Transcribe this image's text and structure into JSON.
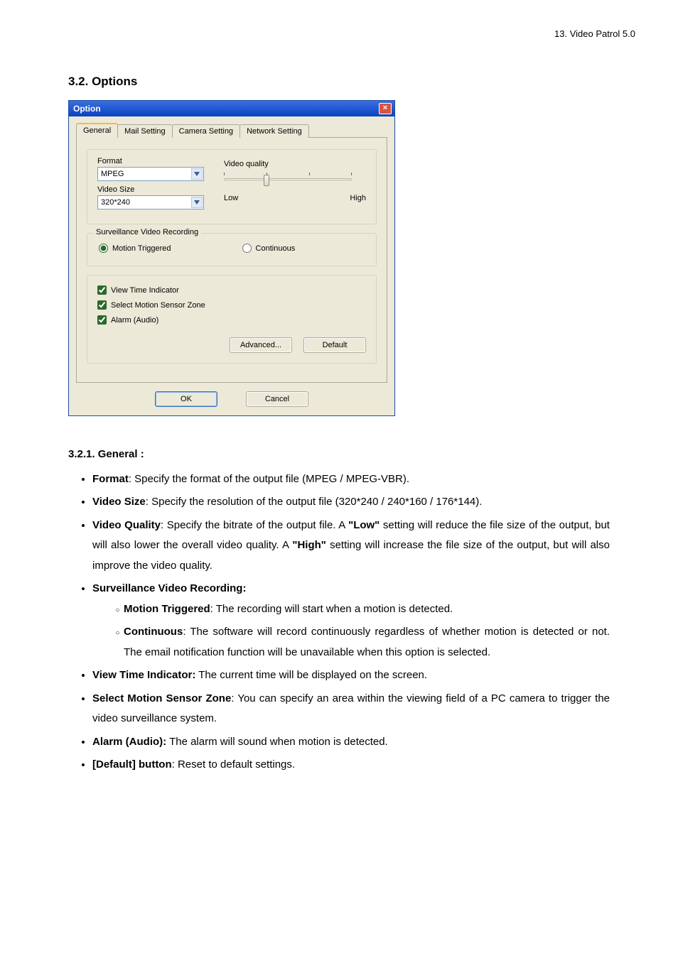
{
  "page": {
    "header_right": "13. Video Patrol 5.0",
    "section_title": "3.2. Options"
  },
  "dialog": {
    "title": "Option",
    "close_glyph": "×",
    "tabs": [
      "General",
      "Mail Setting",
      "Camera Setting",
      "Network Setting"
    ],
    "general": {
      "format_label": "Format",
      "format_value": "MPEG",
      "video_size_label": "Video Size",
      "video_size_value": "320*240",
      "video_quality_label": "Video quality",
      "slider_low": "Low",
      "slider_high": "High",
      "recording_legend": "Surveillance Video Recording",
      "radio_motion": "Motion Triggered",
      "radio_continuous": "Continuous",
      "check_view_time": "View Time Indicator",
      "check_sensor_zone": "Select Motion Sensor Zone",
      "check_alarm": "Alarm (Audio)",
      "btn_advanced": "Advanced...",
      "btn_default": "Default",
      "btn_ok": "OK",
      "btn_cancel": "Cancel"
    }
  },
  "doc": {
    "sub_title": "3.2.1. General :",
    "i1a": "Format",
    "i1b": ": Specify the format of the output file (MPEG / MPEG-VBR).",
    "i2a": "Video Size",
    "i2b": ": Specify the resolution of the output file (320*240 / 240*160 / 176*144).",
    "i3a": "Video Quality",
    "i3b": ": Specify the bitrate of the output file. A ",
    "i3c": "\"Low\"",
    "i3d": " setting will reduce the file size of the output, but will also lower the overall video quality. A ",
    "i3e": "\"High\"",
    "i3f": " setting will increase the file size of the output, but will also improve the video quality.",
    "i4a": "Surveillance Video Recording:",
    "i4_1a": "Motion Triggered",
    "i4_1b": ": The recording will start when a motion is detected.",
    "i4_2a": "Continuous",
    "i4_2b": ": The software will record continuously regardless of whether motion is detected or not.   The email notification function will be unavailable when this option is selected.",
    "i5a": "View Time Indicator:",
    "i5b": " The current time will be displayed on the screen.",
    "i6a": "Select Motion Sensor Zone",
    "i6b": ": You can specify an area within the viewing field of a PC camera to trigger the video surveillance system.",
    "i7a": "Alarm (Audio):",
    "i7b": " The alarm will sound when motion is detected.",
    "i8a": "[Default] button",
    "i8b": ": Reset to default settings."
  }
}
